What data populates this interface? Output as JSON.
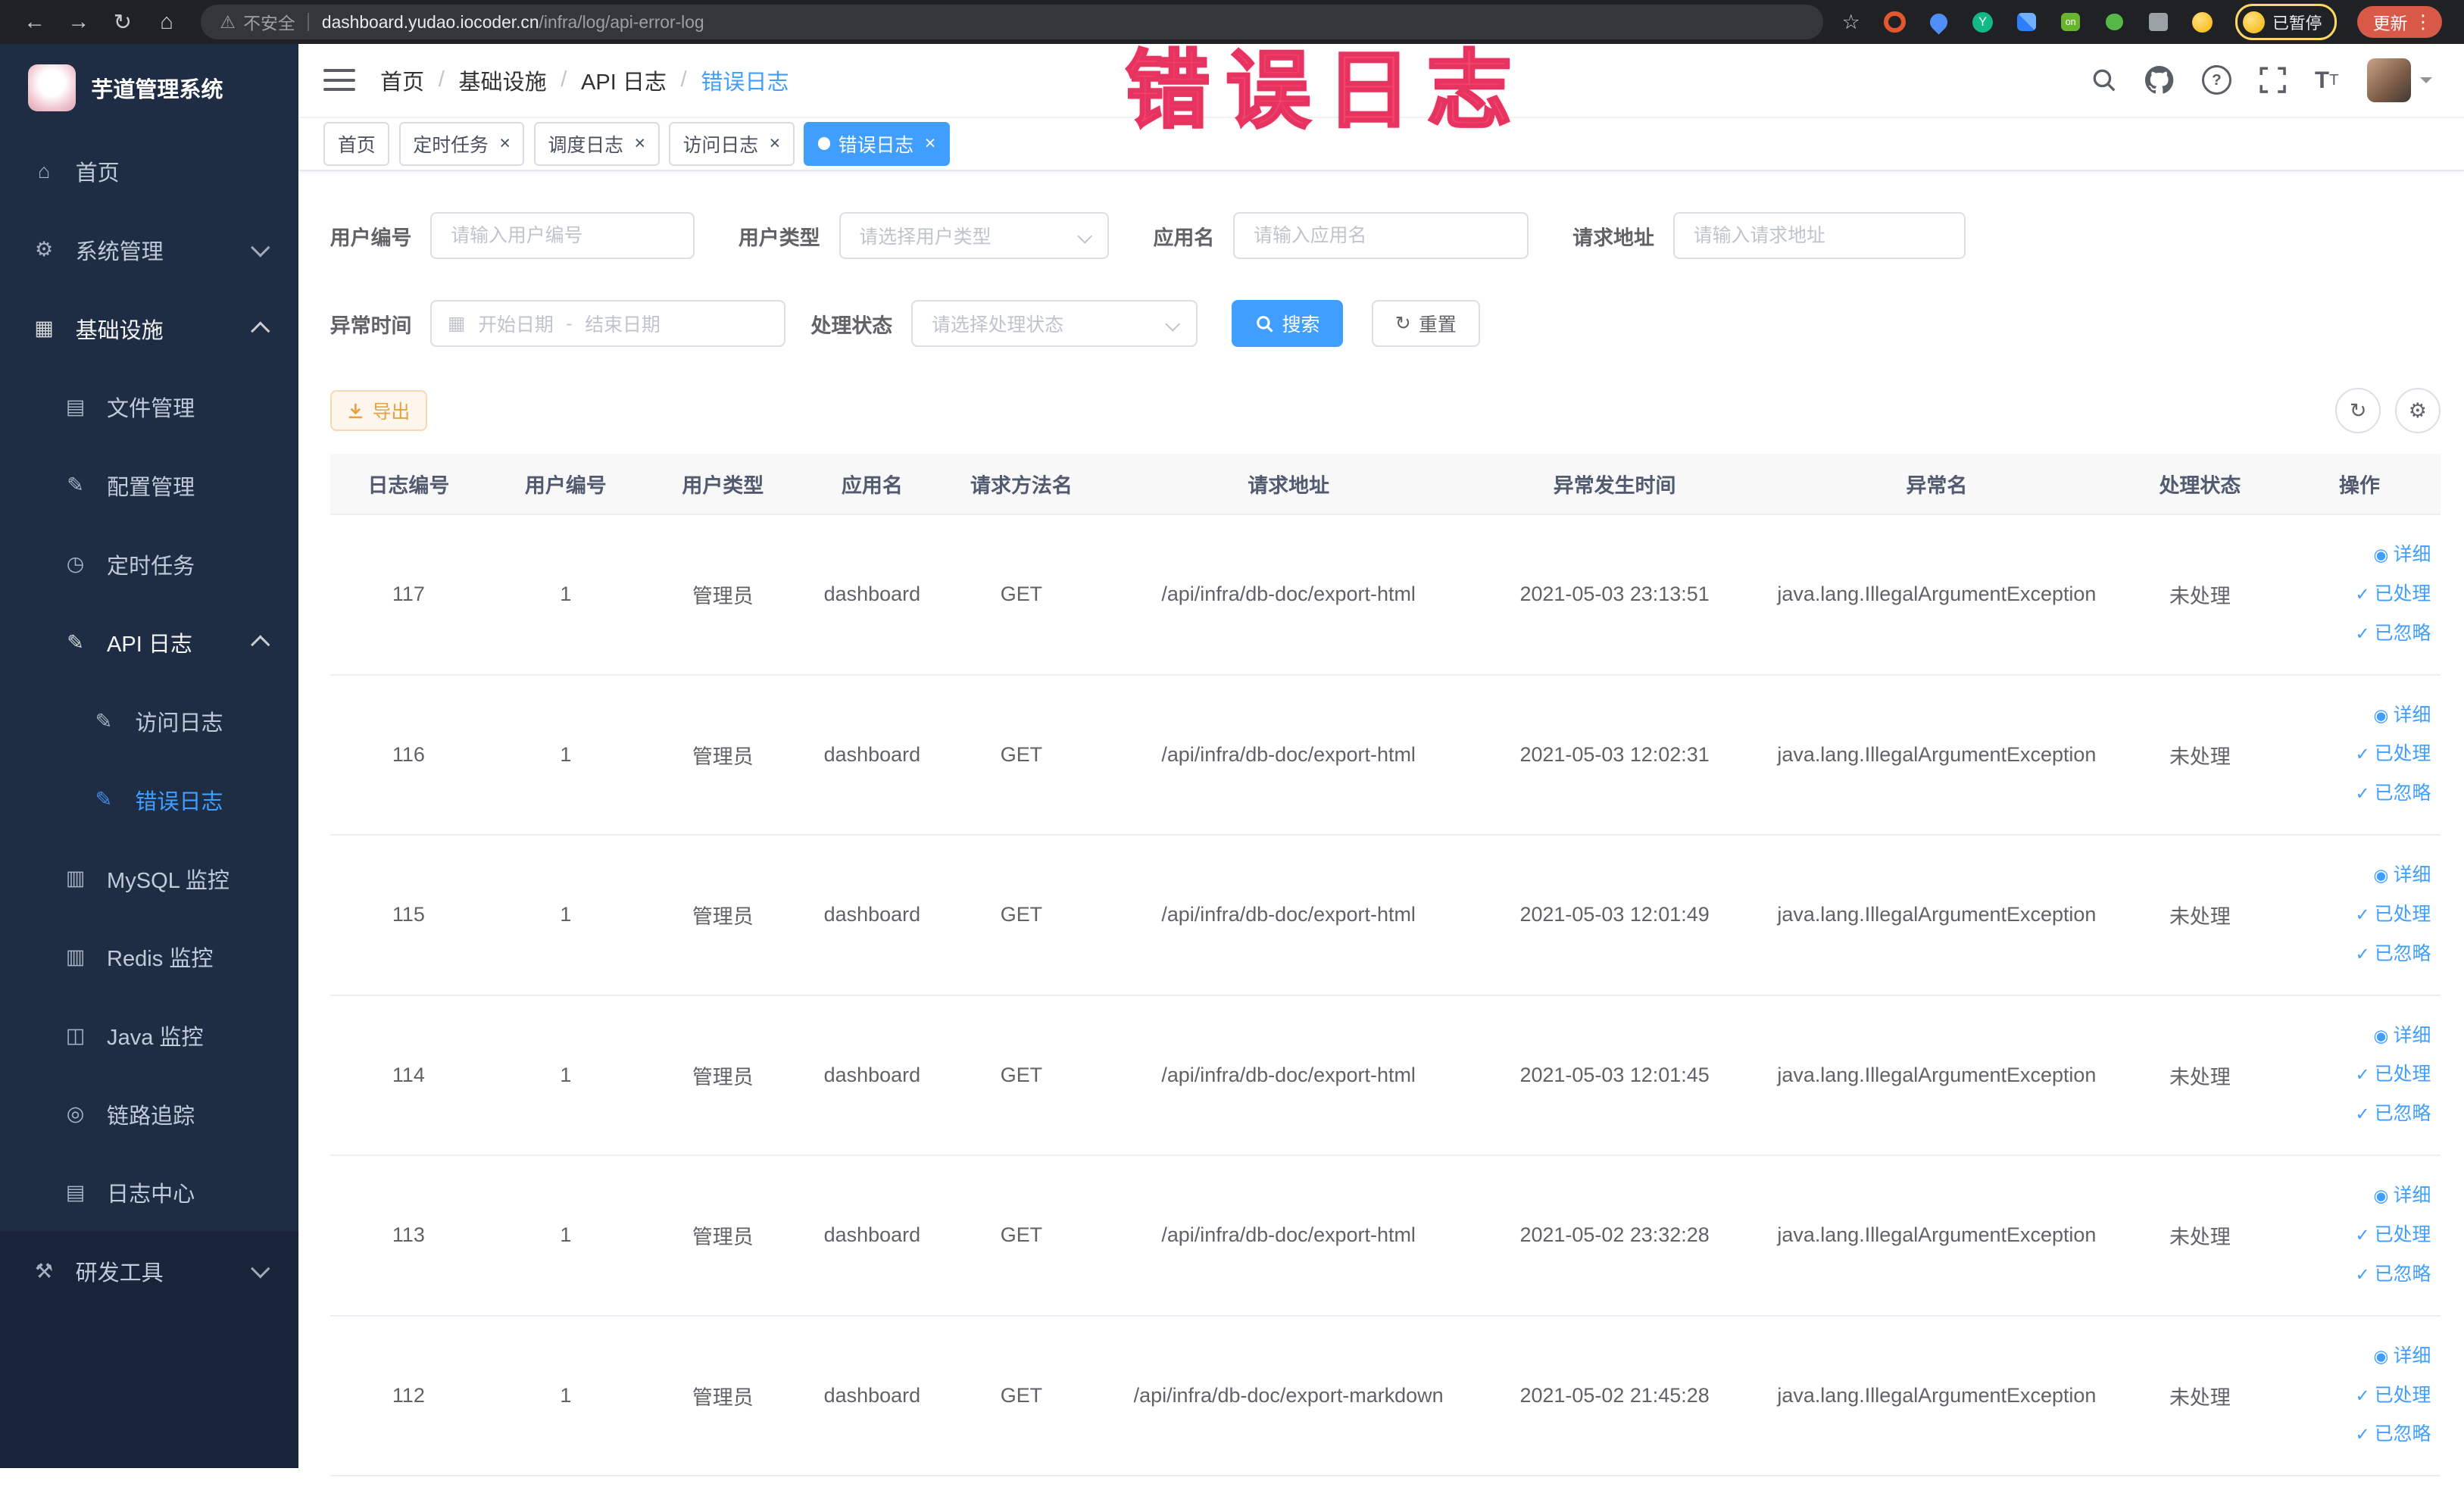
{
  "annotation": {
    "text": "错误日志"
  },
  "browser": {
    "security_label": "不安全",
    "url_domain": "dashboard.yudao.iocoder.cn",
    "url_path": "/infra/log/api-error-log",
    "paused_badge": "已暂停",
    "update_button": "更新"
  },
  "sidebar": {
    "logo_title": "芋道管理系统",
    "items": [
      {
        "label": "首页",
        "icon": "home-icon",
        "level": 0
      },
      {
        "label": "系统管理",
        "icon": "gear-icon",
        "level": 0,
        "chevron": "down"
      },
      {
        "label": "基础设施",
        "icon": "infra-icon",
        "level": 0,
        "chevron": "up"
      },
      {
        "label": "文件管理",
        "icon": "file-icon",
        "level": 1
      },
      {
        "label": "配置管理",
        "icon": "config-icon",
        "level": 1
      },
      {
        "label": "定时任务",
        "icon": "job-icon",
        "level": 1
      },
      {
        "label": "API 日志",
        "icon": "api-log-icon",
        "level": 1,
        "chevron": "up"
      },
      {
        "label": "访问日志",
        "icon": "doc-icon",
        "level": 2
      },
      {
        "label": "错误日志",
        "icon": "doc-icon",
        "level": 2,
        "active": true
      },
      {
        "label": "MySQL 监控",
        "icon": "mysql-icon",
        "level": 1
      },
      {
        "label": "Redis 监控",
        "icon": "redis-icon",
        "level": 1
      },
      {
        "label": "Java 监控",
        "icon": "java-icon",
        "level": 1
      },
      {
        "label": "链路追踪",
        "icon": "trace-icon",
        "level": 1
      },
      {
        "label": "日志中心",
        "icon": "log-center-icon",
        "level": 1
      },
      {
        "label": "研发工具",
        "icon": "tools-icon",
        "level": 0,
        "chevron": "down",
        "section": "dark"
      }
    ]
  },
  "header": {
    "breadcrumb": [
      "首页",
      "基础设施",
      "API 日志",
      "错误日志"
    ]
  },
  "tabs": [
    {
      "label": "首页",
      "closable": false,
      "active": false
    },
    {
      "label": "定时任务",
      "closable": true,
      "active": false
    },
    {
      "label": "调度日志",
      "closable": true,
      "active": false
    },
    {
      "label": "访问日志",
      "closable": true,
      "active": false
    },
    {
      "label": "错误日志",
      "closable": true,
      "active": true
    }
  ],
  "filters": {
    "user_id_label": "用户编号",
    "user_id_placeholder": "请输入用户编号",
    "user_type_label": "用户类型",
    "user_type_placeholder": "请选择用户类型",
    "app_name_label": "应用名",
    "app_name_placeholder": "请输入应用名",
    "request_url_label": "请求地址",
    "request_url_placeholder": "请输入请求地址",
    "exception_time_label": "异常时间",
    "start_date_placeholder": "开始日期",
    "date_separator": "-",
    "end_date_placeholder": "结束日期",
    "process_status_label": "处理状态",
    "process_status_placeholder": "请选择处理状态",
    "search_button": "搜索",
    "reset_button": "重置"
  },
  "toolbar": {
    "export_label": "导出"
  },
  "table": {
    "columns": [
      "日志编号",
      "用户编号",
      "用户类型",
      "应用名",
      "请求方法名",
      "请求地址",
      "异常发生时间",
      "异常名",
      "处理状态",
      "操作"
    ],
    "action_labels": [
      "详细",
      "已处理",
      "已忽略"
    ],
    "rows": [
      {
        "id": "117",
        "user_id": "1",
        "user_type": "管理员",
        "app": "dashboard",
        "method": "GET",
        "url": "/api/infra/db-doc/export-html",
        "time": "2021-05-03 23:13:51",
        "exception": "java.lang.IllegalArgumentException",
        "status": "未处理"
      },
      {
        "id": "116",
        "user_id": "1",
        "user_type": "管理员",
        "app": "dashboard",
        "method": "GET",
        "url": "/api/infra/db-doc/export-html",
        "time": "2021-05-03 12:02:31",
        "exception": "java.lang.IllegalArgumentException",
        "status": "未处理"
      },
      {
        "id": "115",
        "user_id": "1",
        "user_type": "管理员",
        "app": "dashboard",
        "method": "GET",
        "url": "/api/infra/db-doc/export-html",
        "time": "2021-05-03 12:01:49",
        "exception": "java.lang.IllegalArgumentException",
        "status": "未处理"
      },
      {
        "id": "114",
        "user_id": "1",
        "user_type": "管理员",
        "app": "dashboard",
        "method": "GET",
        "url": "/api/infra/db-doc/export-html",
        "time": "2021-05-03 12:01:45",
        "exception": "java.lang.IllegalArgumentException",
        "status": "未处理"
      },
      {
        "id": "113",
        "user_id": "1",
        "user_type": "管理员",
        "app": "dashboard",
        "method": "GET",
        "url": "/api/infra/db-doc/export-html",
        "time": "2021-05-02 23:32:28",
        "exception": "java.lang.IllegalArgumentException",
        "status": "未处理"
      },
      {
        "id": "112",
        "user_id": "1",
        "user_type": "管理员",
        "app": "dashboard",
        "method": "GET",
        "url": "/api/infra/db-doc/export-markdown",
        "time": "2021-05-02 21:45:28",
        "exception": "java.lang.IllegalArgumentException",
        "status": "未处理"
      }
    ]
  }
}
